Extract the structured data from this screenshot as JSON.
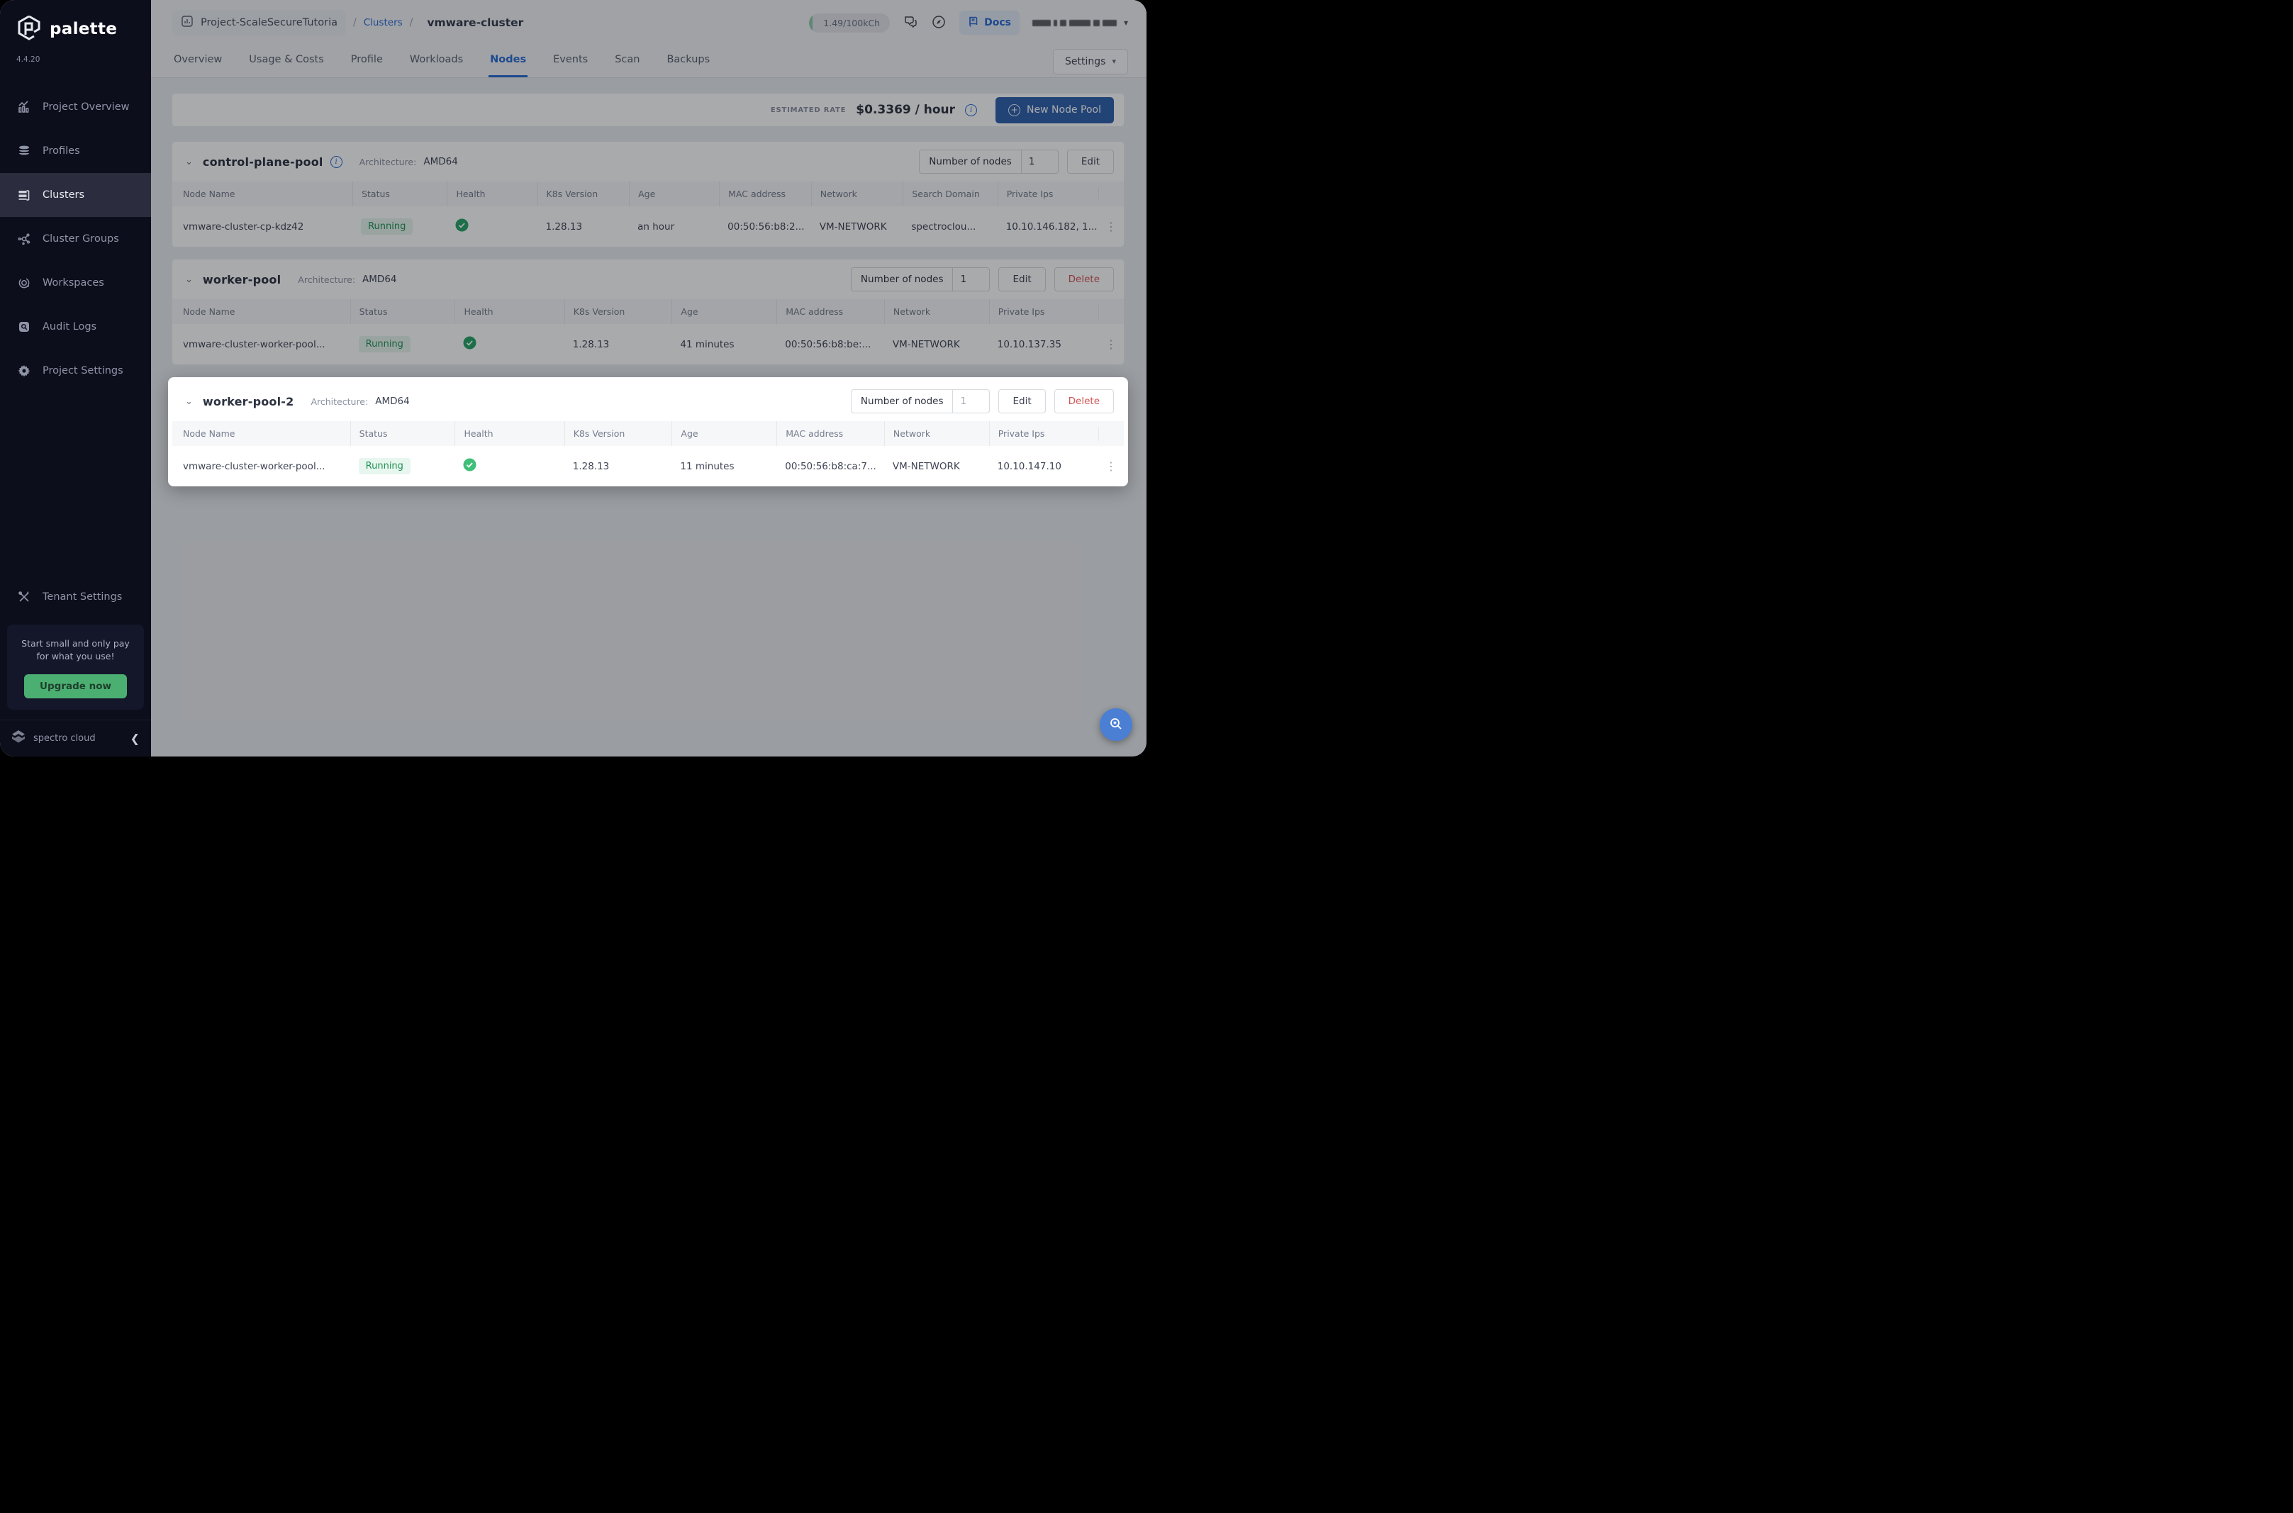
{
  "brand": {
    "name": "palette",
    "version": "4.4.20",
    "footer": "spectro cloud"
  },
  "sidebar": {
    "items": [
      {
        "label": "Project Overview"
      },
      {
        "label": "Profiles"
      },
      {
        "label": "Clusters"
      },
      {
        "label": "Cluster Groups"
      },
      {
        "label": "Workspaces"
      },
      {
        "label": "Audit Logs"
      },
      {
        "label": "Project Settings"
      }
    ],
    "tenant_settings": "Tenant Settings",
    "upgrade_message": "Start small and only pay for what you use!",
    "upgrade_button": "Upgrade now"
  },
  "header": {
    "project": "Project-ScaleSecureTutoria",
    "sep1": "/",
    "clusters_link": "Clusters",
    "sep2": "/",
    "cluster_name": "vmware-cluster",
    "usage": "1.49/100kCh",
    "docs": "Docs"
  },
  "tabs": {
    "items": [
      "Overview",
      "Usage & Costs",
      "Profile",
      "Workloads",
      "Nodes",
      "Events",
      "Scan",
      "Backups"
    ],
    "active": "Nodes",
    "settings": "Settings"
  },
  "toolbar": {
    "rate_label": "ESTIMATED RATE",
    "rate_value": "$0.3369 / hour",
    "new_pool": "New Node Pool"
  },
  "pools": [
    {
      "name": "control-plane-pool",
      "arch_label": "Architecture:",
      "arch": "AMD64",
      "nodes_label": "Number of nodes",
      "nodes_value": "1",
      "edit": "Edit",
      "columns": [
        "Node Name",
        "Status",
        "Health",
        "K8s Version",
        "Age",
        "MAC address",
        "Network",
        "Search Domain",
        "Private Ips"
      ],
      "row": {
        "name": "vmware-cluster-cp-kdz42",
        "status": "Running",
        "k8s": "1.28.13",
        "age": "an hour",
        "mac": "00:50:56:b8:2...",
        "network": "VM-NETWORK",
        "domain": "spectroclou...",
        "ips": "10.10.146.182, 1..."
      }
    },
    {
      "name": "worker-pool",
      "arch_label": "Architecture:",
      "arch": "AMD64",
      "nodes_label": "Number of nodes",
      "nodes_value": "1",
      "edit": "Edit",
      "delete": "Delete",
      "columns": [
        "Node Name",
        "Status",
        "Health",
        "K8s Version",
        "Age",
        "MAC address",
        "Network",
        "Private Ips"
      ],
      "row": {
        "name": "vmware-cluster-worker-pool...",
        "status": "Running",
        "k8s": "1.28.13",
        "age": "41 minutes",
        "mac": "00:50:56:b8:be:...",
        "network": "VM-NETWORK",
        "ips": "10.10.137.35"
      }
    },
    {
      "name": "worker-pool-2",
      "arch_label": "Architecture:",
      "arch": "AMD64",
      "nodes_label": "Number of nodes",
      "nodes_value": "1",
      "edit": "Edit",
      "delete": "Delete",
      "columns": [
        "Node Name",
        "Status",
        "Health",
        "K8s Version",
        "Age",
        "MAC address",
        "Network",
        "Private Ips"
      ],
      "row": {
        "name": "vmware-cluster-worker-pool...",
        "status": "Running",
        "k8s": "1.28.13",
        "age": "11 minutes",
        "mac": "00:50:56:b8:ca:7...",
        "network": "VM-NETWORK",
        "ips": "10.10.147.10"
      }
    }
  ],
  "colors": {
    "accent_blue": "#2a6bd4",
    "success_green": "#27a567",
    "delete_red": "#d25555",
    "sidebar_bg": "#0d0e1c",
    "upgrade_green": "#4caf72"
  }
}
